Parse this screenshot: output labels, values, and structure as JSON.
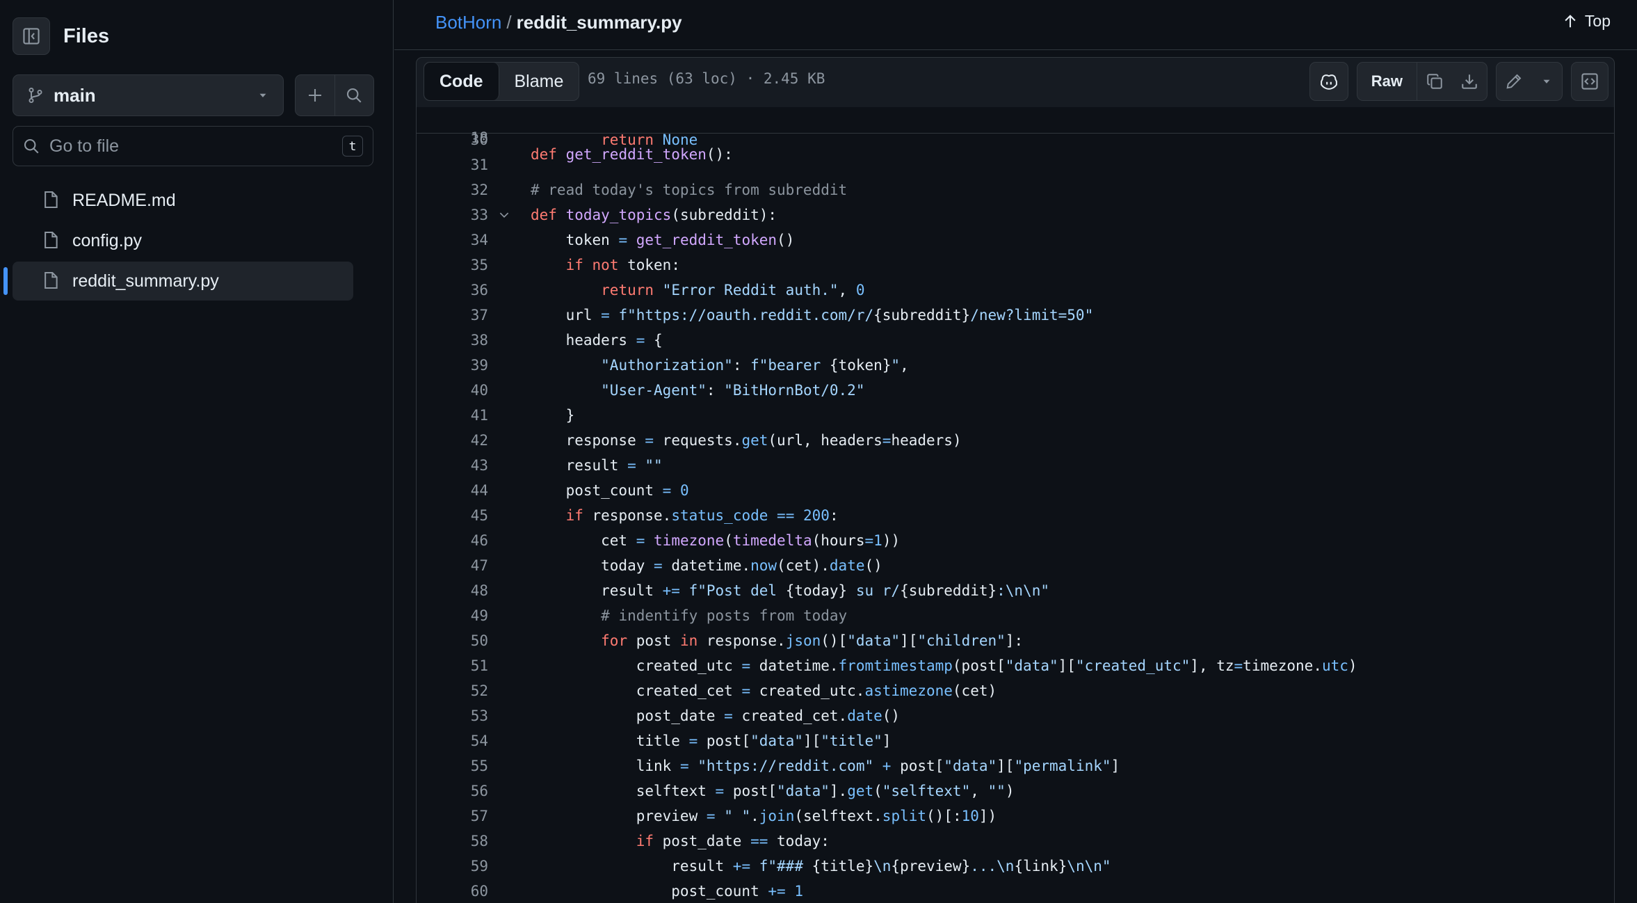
{
  "sidebar": {
    "title": "Files",
    "branch": "main",
    "goto_placeholder": "Go to file",
    "goto_shortcut": "t",
    "files": [
      {
        "name": "README.md",
        "active": false
      },
      {
        "name": "config.py",
        "active": false
      },
      {
        "name": "reddit_summary.py",
        "active": true
      }
    ]
  },
  "breadcrumb": {
    "repo": "BotHorn",
    "separator": "/",
    "file": "reddit_summary.py"
  },
  "top_button": "Top",
  "code_header": {
    "tab_code": "Code",
    "tab_blame": "Blame",
    "file_info": "69 lines (63 loc) · 2.45 KB",
    "raw_label": "Raw"
  },
  "sticky_line": {
    "num": "18",
    "text": "def get_reddit_token():"
  },
  "code_lines": [
    {
      "num": "30",
      "text": "        return None"
    },
    {
      "num": "31",
      "text": ""
    },
    {
      "num": "32",
      "text": "# read today's topics from subreddit"
    },
    {
      "num": "33",
      "text": "def today_topics(subreddit):"
    },
    {
      "num": "34",
      "text": "    token = get_reddit_token()"
    },
    {
      "num": "35",
      "text": "    if not token:"
    },
    {
      "num": "36",
      "text": "        return \"Error Reddit auth.\", 0"
    },
    {
      "num": "37",
      "text": "    url = f\"https://oauth.reddit.com/r/{subreddit}/new?limit=50\""
    },
    {
      "num": "38",
      "text": "    headers = {"
    },
    {
      "num": "39",
      "text": "        \"Authorization\": f\"bearer {token}\","
    },
    {
      "num": "40",
      "text": "        \"User-Agent\": \"BitHornBot/0.2\""
    },
    {
      "num": "41",
      "text": "    }"
    },
    {
      "num": "42",
      "text": "    response = requests.get(url, headers=headers)"
    },
    {
      "num": "43",
      "text": "    result = \"\""
    },
    {
      "num": "44",
      "text": "    post_count = 0"
    },
    {
      "num": "45",
      "text": "    if response.status_code == 200:"
    },
    {
      "num": "46",
      "text": "        cet = timezone(timedelta(hours=1))"
    },
    {
      "num": "47",
      "text": "        today = datetime.now(cet).date()"
    },
    {
      "num": "48",
      "text": "        result += f\"Post del {today} su r/{subreddit}:\\n\\n\""
    },
    {
      "num": "49",
      "text": "        # indentify posts from today"
    },
    {
      "num": "50",
      "text": "        for post in response.json()[\"data\"][\"children\"]:"
    },
    {
      "num": "51",
      "text": "            created_utc = datetime.fromtimestamp(post[\"data\"][\"created_utc\"], tz=timezone.utc)"
    },
    {
      "num": "52",
      "text": "            created_cet = created_utc.astimezone(cet)"
    },
    {
      "num": "53",
      "text": "            post_date = created_cet.date()"
    },
    {
      "num": "54",
      "text": "            title = post[\"data\"][\"title\"]"
    },
    {
      "num": "55",
      "text": "            link = \"https://reddit.com\" + post[\"data\"][\"permalink\"]"
    },
    {
      "num": "56",
      "text": "            selftext = post[\"data\"].get(\"selftext\", \"\")"
    },
    {
      "num": "57",
      "text": "            preview = \" \".join(selftext.split()[:10])"
    },
    {
      "num": "58",
      "text": "            if post_date == today:"
    },
    {
      "num": "59",
      "text": "                result += f\"### {title}\\n{preview}...\\n{link}\\n\\n\""
    },
    {
      "num": "60",
      "text": "                post_count += 1"
    }
  ],
  "colors": {
    "background": "#0d1117",
    "border": "#30363d",
    "accent": "#4493f8",
    "keyword": "#ff7b72",
    "string": "#a5d6ff",
    "function": "#d2a8ff",
    "constant": "#79c0ff",
    "comment": "#8b949e"
  },
  "icons": {
    "sidebar_toggle": "sidebar-collapse-icon",
    "branch": "git-branch-icon",
    "add": "plus-icon",
    "search": "search-icon",
    "file": "file-icon",
    "top": "arrow-up-icon",
    "copilot": "copilot-icon",
    "copy": "copy-icon",
    "download": "download-icon",
    "edit": "pencil-icon",
    "more": "triangle-down-icon",
    "symbols": "code-square-icon",
    "fold": "chevron-down-icon"
  }
}
